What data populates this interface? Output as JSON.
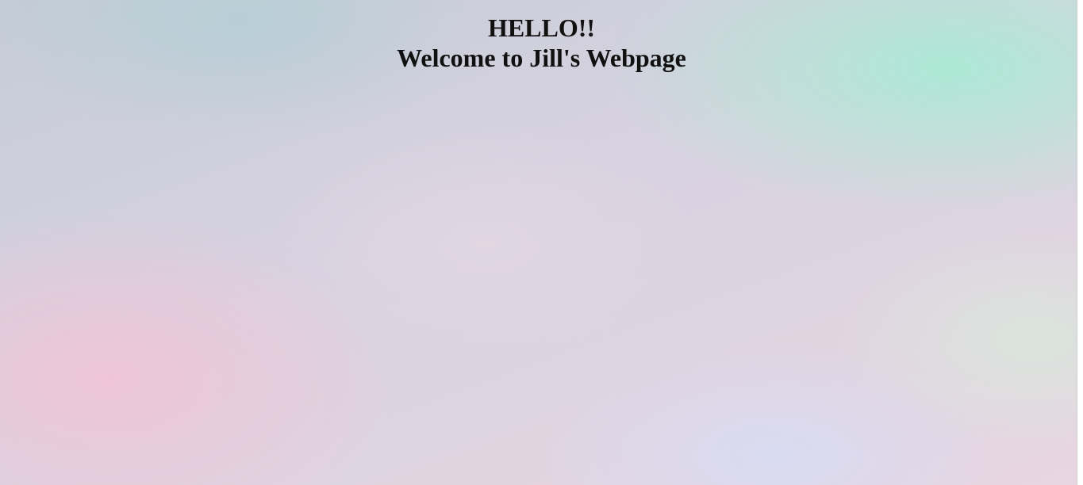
{
  "page": {
    "greeting": "HELLO!!",
    "welcome": "Welcome to Jill's Webpage"
  },
  "colors": {
    "text": "#111111",
    "background_pink": "#f0c4d8",
    "background_mint": "#aaead4",
    "background_lavender": "#d8dcf2"
  }
}
